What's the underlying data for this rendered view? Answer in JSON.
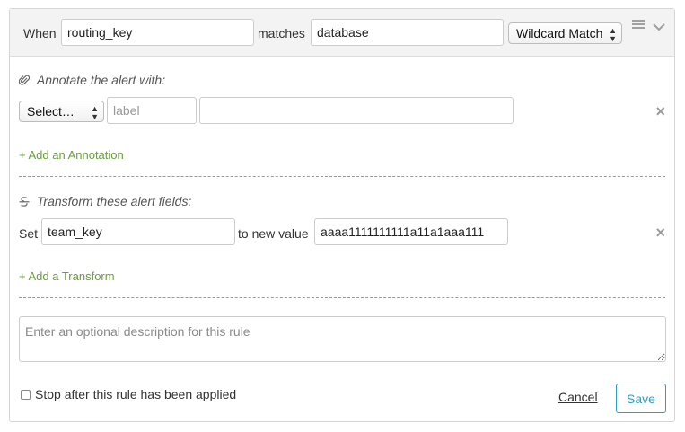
{
  "header": {
    "when_label": "When",
    "field_value": "routing_key",
    "matches_label": "matches",
    "pattern_value": "database",
    "match_type": "Wildcard Match",
    "menu_icon": "hamburger-icon",
    "collapse_icon": "chevron-down-icon"
  },
  "annotate": {
    "title": "Annotate the alert with:",
    "icon": "paperclip-icon",
    "select_label": "Select…",
    "label_placeholder": "label",
    "value": "",
    "remove_glyph": "×",
    "add_link": "+ Add an Annotation"
  },
  "transform": {
    "title": "Transform these alert fields:",
    "icon": "strikethrough-icon",
    "set_label": "Set",
    "field_value": "team_key",
    "to_label": "to new value",
    "new_value": "aaaa1111111111a11a1aaa111",
    "remove_glyph": "×",
    "add_link": "+ Add a Transform"
  },
  "description": {
    "placeholder": "Enter an optional description for this rule",
    "value": ""
  },
  "footer": {
    "stop_label": "Stop after this rule has been applied",
    "cancel_label": "Cancel",
    "save_label": "Save"
  },
  "colors": {
    "link_green": "#6a9f3c",
    "save_blue": "#2aa0c8",
    "header_bg": "#f3f3f3"
  }
}
